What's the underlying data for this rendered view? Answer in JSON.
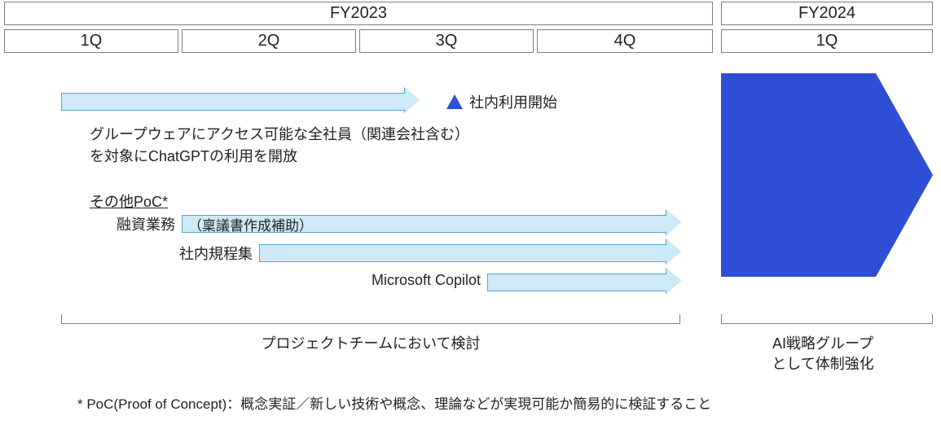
{
  "header": {
    "fy2023": "FY2023",
    "fy2024": "FY2024",
    "q1": "1Q",
    "q2": "2Q",
    "q3": "3Q",
    "q4": "4Q",
    "fy24_q1": "1Q"
  },
  "milestone": {
    "label": "社内利用開始"
  },
  "chatgpt_desc": {
    "line1": "グループウェアにアクセス可能な全社員（関連会社含む）",
    "line2": "を対象にChatGPTの利用を開放"
  },
  "poc": {
    "title": "その他PoC*",
    "rows": {
      "r1_label": "融資業務",
      "r1_inner": "（稟議書作成補助）",
      "r2_label": "社内規程集",
      "r3_label": "Microsoft Copilot"
    }
  },
  "brackets": {
    "left": "プロジェクトチームにおいて検討",
    "right_l1": "AI戦略グループ",
    "right_l2": "として体制強化"
  },
  "footnote": "* PoC(Proof of Concept)：概念実証／新しい技術や概念、理論などが実現可能か簡易的に検証すること"
}
